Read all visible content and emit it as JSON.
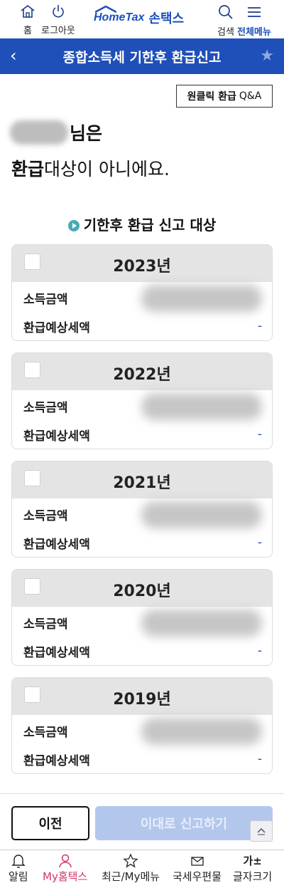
{
  "header": {
    "home_label": "홈",
    "logout_label": "로그아웃",
    "logo_text": "HomeTax",
    "logo_sub": "손택스",
    "search_label": "검색",
    "menu_label": "전체메뉴"
  },
  "titlebar": {
    "title": "종합소득세 기한후 환급신고"
  },
  "qa_button": {
    "bold": "원클릭 환급",
    "thin": "Q&A"
  },
  "message": {
    "suffix": "님은",
    "line2_highlight": "환급",
    "line2_rest_bold": "대상",
    "line2_rest": "이 아니에요."
  },
  "section_title": "기한후 환급 신고 대상",
  "cards": [
    {
      "year": "2023년",
      "income_label": "소득금액",
      "refund_label": "환급예상세액",
      "refund_value": "-"
    },
    {
      "year": "2022년",
      "income_label": "소득금액",
      "refund_label": "환급예상세액",
      "refund_value": "-"
    },
    {
      "year": "2021년",
      "income_label": "소득금액",
      "refund_label": "환급예상세액",
      "refund_value": "-"
    },
    {
      "year": "2020년",
      "income_label": "소득금액",
      "refund_label": "환급예상세액",
      "refund_value": "-"
    },
    {
      "year": "2019년",
      "income_label": "소득금액",
      "refund_label": "환급예상세액",
      "refund_value": "-"
    }
  ],
  "actions": {
    "prev_label": "이전",
    "submit_label": "이대로 신고하기"
  },
  "bottom_nav": [
    {
      "label": "알림",
      "icon": "bell-icon"
    },
    {
      "label": "My홈택스",
      "icon": "person-icon"
    },
    {
      "label": "최근/My메뉴",
      "icon": "star-icon"
    },
    {
      "label": "국세우편물",
      "icon": "mail-icon"
    },
    {
      "label": "글자크기",
      "icon": "font-size-icon"
    }
  ],
  "colors": {
    "brand_blue": "#1f4fb8",
    "active_pink": "#d6336c",
    "highlight": "#f7b6a2",
    "disabled_button": "#b3c7ec"
  }
}
